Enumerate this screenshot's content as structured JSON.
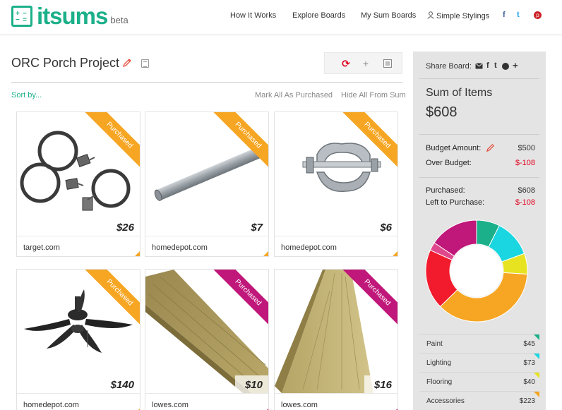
{
  "header": {
    "logo_text": "itsums",
    "logo_beta": "beta",
    "nav": [
      "How It Works",
      "Explore Boards",
      "My Sum Boards",
      "Simple Stylings"
    ],
    "social_icons": [
      "facebook-icon",
      "twitter-icon",
      "pinterest-icon"
    ],
    "social_glyphs": [
      "f",
      "t",
      "p"
    ]
  },
  "board": {
    "title": "ORC Porch Project",
    "sort_by": "Sort by...",
    "mark_all": "Mark All As Purchased",
    "hide_all": "Hide All From Sum"
  },
  "items": [
    {
      "store": "target.com",
      "price": "$26",
      "status": "Purchased",
      "ribbon_color": "#f6a623"
    },
    {
      "store": "homedepot.com",
      "price": "$7",
      "status": "Purchased",
      "ribbon_color": "#f6a623"
    },
    {
      "store": "homedepot.com",
      "price": "$6",
      "status": "Purchased",
      "ribbon_color": "#f6a623"
    },
    {
      "store": "homedepot.com",
      "price": "$140",
      "status": "Purchased",
      "ribbon_color": "#f6a623"
    },
    {
      "store": "lowes.com",
      "price": "$10",
      "status": "Purchased",
      "ribbon_color": "#c0177a"
    },
    {
      "store": "lowes.com",
      "price": "$16",
      "status": "Purchased",
      "ribbon_color": "#c0177a"
    }
  ],
  "panel": {
    "share_label": "Share Board:",
    "sum_label": "Sum of Items",
    "sum_value": "$608",
    "budget_label": "Budget Amount:",
    "budget_value": "$500",
    "over_label": "Over Budget:",
    "over_value": "$-108",
    "purchased_label": "Purchased:",
    "purchased_value": "$608",
    "left_label": "Left to Purchase:",
    "left_value": "$-108",
    "categories": [
      {
        "name": "Paint",
        "value": "$45",
        "color": "#1cb08a"
      },
      {
        "name": "Lighting",
        "value": "$73",
        "color": "#1ad6e0"
      },
      {
        "name": "Flooring",
        "value": "$40",
        "color": "#e8e321"
      },
      {
        "name": "Accessories",
        "value": "$223",
        "color": "#f6a623"
      }
    ]
  },
  "chart_data": {
    "type": "pie",
    "segments": [
      {
        "color": "#1cb08a",
        "value": 45
      },
      {
        "color": "#1ad6e0",
        "value": 73
      },
      {
        "color": "#e8e321",
        "value": 40
      },
      {
        "color": "#f6a623",
        "value": 223
      },
      {
        "color": "#f21b2d",
        "value": 116
      },
      {
        "color": "#e0488e",
        "value": 16
      },
      {
        "color": "#c0177a",
        "value": 95
      }
    ]
  },
  "colors": {
    "brand": "#1cb08a",
    "accent_red": "#e0001b",
    "purchased_orange": "#f6a623",
    "purchased_pink": "#c0177a"
  }
}
